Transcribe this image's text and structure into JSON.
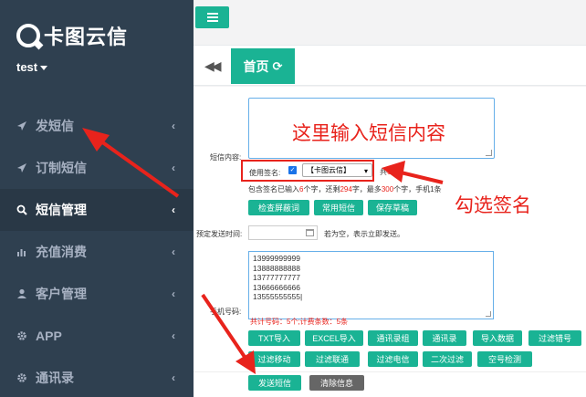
{
  "app": {
    "logo_text": "卡图云信",
    "username": "test"
  },
  "sidebar": {
    "items": [
      {
        "label": "发短信",
        "icon": "paper-plane-icon"
      },
      {
        "label": "订制短信",
        "icon": "paper-plane-icon"
      },
      {
        "label": "短信管理",
        "icon": "search-icon",
        "active": true
      },
      {
        "label": "充值消费",
        "icon": "bar-chart-icon"
      },
      {
        "label": "客户管理",
        "icon": "user-icon"
      },
      {
        "label": "APP",
        "icon": "gear-icon"
      },
      {
        "label": "通讯录",
        "icon": "gear-icon"
      }
    ]
  },
  "tabs": {
    "home_label": "首页"
  },
  "form": {
    "content_label": "短信内容:",
    "sign_label": "使用签名:",
    "sign_value": "【卡图云信】",
    "count_prefix": "共",
    "count_value": "6",
    "count_suffix": "字",
    "info": {
      "p1": "包含签名已输入",
      "v1": "6",
      "p2": "个字，还剩",
      "v2": "294",
      "p3": "字，最多",
      "v3": "300",
      "p4": "个字，手机1条"
    },
    "btn_check": "检查屏蔽词",
    "btn_common": "常用短信",
    "btn_draft": "保存草稿",
    "time_label": "预定发送时间:",
    "time_hint": "若为空，表示立即发送。",
    "phone_label": "手机号码:",
    "phones": [
      "13999999999",
      "13888888888",
      "13777777777",
      "13666666666",
      "13555555555|"
    ],
    "stat_line": "共计号码：5个;计费条数：5条",
    "row1": [
      "TXT导入",
      "EXCEL导入",
      "通讯录组",
      "通讯录",
      "导入数据",
      "过滤错号"
    ],
    "row2": [
      "过滤移动",
      "过滤联通",
      "过滤电信",
      "二次过滤",
      "空号检测"
    ],
    "send": "发送短信",
    "clear": "清除信息"
  },
  "annotations": {
    "content_hint": "这里输入短信内容",
    "sign_hint": "勾选签名"
  },
  "colors": {
    "sidebar": "#2f4050",
    "accent": "#1ab394",
    "annotation": "#e8231c"
  }
}
